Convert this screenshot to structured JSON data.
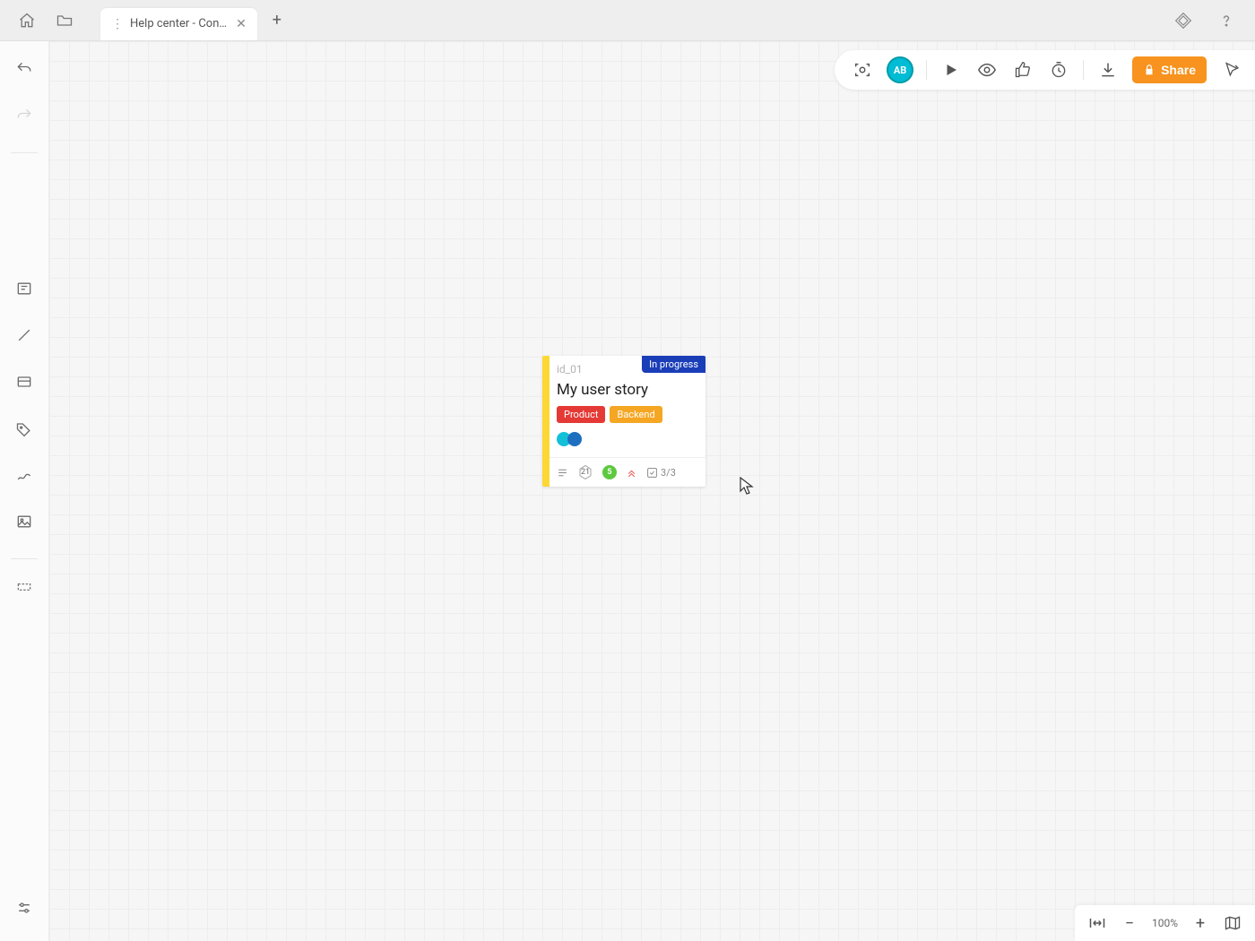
{
  "titlebar": {
    "tab_label": "Help center - Con…"
  },
  "top_right": {
    "avatar_initials": "AB",
    "share_label": "Share"
  },
  "card": {
    "id": "id_01",
    "status": "In progress",
    "title": "My user story",
    "tags": [
      {
        "label": "Product",
        "color": "#e53935"
      },
      {
        "label": "Backend",
        "color": "#f5a623"
      }
    ],
    "avatars": [
      {
        "color": "#14c0d8"
      },
      {
        "color": "#1f6fc0"
      }
    ],
    "footer": {
      "hex_value": "21",
      "dot_value": "5",
      "checklist": "3/3"
    },
    "accent_color": "#fdd835"
  },
  "zoom": {
    "level": "100%"
  }
}
